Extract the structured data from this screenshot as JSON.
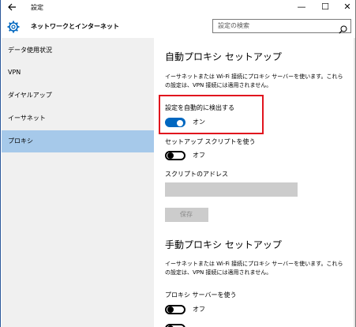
{
  "window": {
    "title": "設定",
    "back_icon": "back-arrow-icon",
    "minimize_glyph": "—",
    "maximize_glyph": "☐",
    "close_glyph": "✕"
  },
  "header": {
    "title": "ネットワークとインターネット",
    "gear_icon": "gear-icon",
    "search_placeholder": "設定の検索",
    "search_icon": "search-icon"
  },
  "sidebar": {
    "items": [
      {
        "label": "データ使用状況",
        "active": false
      },
      {
        "label": "VPN",
        "active": false
      },
      {
        "label": "ダイヤルアップ",
        "active": false
      },
      {
        "label": "イーサネット",
        "active": false
      },
      {
        "label": "プロキシ",
        "active": true
      }
    ]
  },
  "auto_proxy": {
    "title": "自動プロキシ セットアップ",
    "desc_line1": "イーサネットまたは Wi-Fi 接続にプロキシ サーバーを使います。これら",
    "desc_line2": "の設定は、VPN 接続には適用されません。",
    "detect_label": "設定を自動的に検出する",
    "detect_state": "オン",
    "script_label": "セットアップ スクリプトを使う",
    "script_state": "オフ",
    "address_label": "スクリプトのアドレス",
    "address_value": "",
    "save_label": "保存"
  },
  "manual_proxy": {
    "title": "手動プロキシ セットアップ",
    "desc_line1": "イーサネットまたは Wi-Fi 接続にプロキシ サーバーを使います。これら",
    "desc_line2": "の設定は、VPN 接続には適用されません。",
    "use_server_label": "プロキシ サーバーを使う",
    "use_server_state": "オフ"
  },
  "colors": {
    "accent": "#0067c0",
    "sidebar_active": "#a6c9ea",
    "sidebar_bg": "#f0f0f0",
    "highlight_box": "#e1141e",
    "disabled": "#cccccc"
  }
}
